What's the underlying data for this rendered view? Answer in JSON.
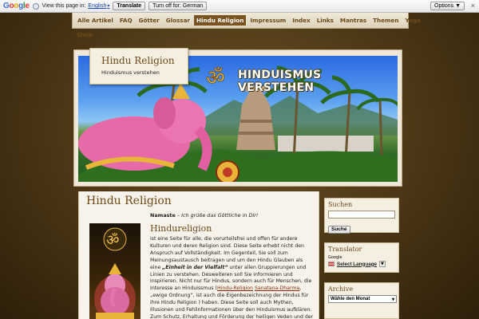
{
  "translate_bar": {
    "logo": [
      "G",
      "o",
      "o",
      "g",
      "l",
      "e"
    ],
    "view_text": "View this page in:",
    "language": "English",
    "translate_btn": "Translate",
    "turn_off_btn": "Turn off for: German",
    "options_btn": "Options ▼",
    "close": "×"
  },
  "nav": {
    "items": [
      "Alle Artikel",
      "FAQ",
      "Götter",
      "Glossar",
      "Hindu Religion",
      "Impressum",
      "Index",
      "Links",
      "Mantras",
      "Themen",
      "Yoga"
    ],
    "active_index": 4,
    "sub_item": "Shop"
  },
  "header": {
    "site_title": "Hindu Religion",
    "site_description": "Hinduismus verstehen",
    "banner_text": "HINDUISMUS VERSTEHEN"
  },
  "content": {
    "page_title": "Hindu Religion",
    "greeting_bold": "Namaste",
    "greeting_italic": "Ich grüße das Göttliche in Dir!",
    "section_title": "Hindureligion",
    "para_1": "ist eine Seite für alle, die vorurteilsfrei und offen für andere Kulturen und deren Religion sind. Diese Seite erhebt nicht den Anspruch auf Vollständigkeit. Im Gegenteil, Sie soll zum Meinungsaustausch beitragen und um den Hindu Glauben als eine ",
    "para_em": "„Einheit in der Vielfalt“",
    "para_2": " unter allen Gruppierungen und Linien zu verstehen. Desweiteren soll Sie informieren und inspirieren. Nicht nur für Hindus, sondern auch für Menschen, die Interesse an Hinduissmus (",
    "link_1": "Hindu-Religion",
    "link_2": "Sanatana-Dharma",
    "para_3": ", „ewige Ordnung“, ist auch die Eigenbezeichnung der Hindus für ihre Hindu Religion ) haben. Diese Seite soll auch Mythen, Illusionen und Fehlinformationen über den Hinduismus aufklären. Zum Schutz, Erhaltung und Förderung der heiligen Veden und der Hindu Religion beitragen. Wie jede andere"
  },
  "sidebar": {
    "search_title": "Suchen",
    "search_button": "Suche",
    "translator_title": "Translator",
    "translator_logo": "Google",
    "select_language": "Select Language",
    "archive_title": "Archive",
    "archive_select": "Wähle den Monat"
  },
  "colors": {
    "accent": "#6b4a1a",
    "nav_active": "#7a5420",
    "link": "#8a2a08"
  }
}
